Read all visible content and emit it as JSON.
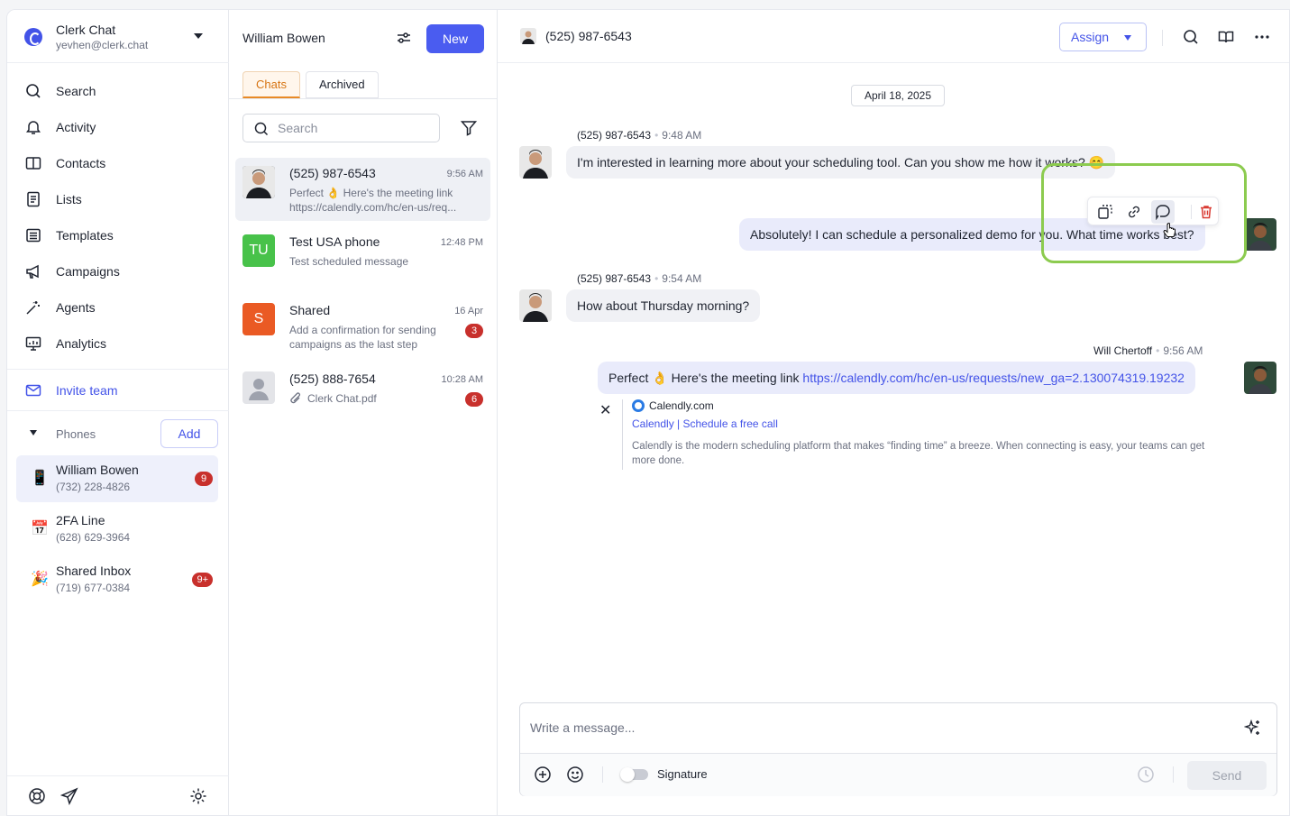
{
  "workspace": {
    "name": "Clerk Chat",
    "email": "yevhen@clerk.chat"
  },
  "nav": [
    {
      "label": "Search",
      "icon": "search-icon"
    },
    {
      "label": "Activity",
      "icon": "bell-icon"
    },
    {
      "label": "Contacts",
      "icon": "book-icon"
    },
    {
      "label": "Lists",
      "icon": "list-icon"
    },
    {
      "label": "Templates",
      "icon": "template-icon"
    },
    {
      "label": "Campaigns",
      "icon": "megaphone-icon"
    },
    {
      "label": "Agents",
      "icon": "wand-icon"
    },
    {
      "label": "Analytics",
      "icon": "chart-icon"
    }
  ],
  "invite": {
    "label": "Invite team"
  },
  "phones": {
    "label": "Phones",
    "add_label": "Add",
    "items": [
      {
        "name": "William Bowen",
        "number": "(732) 228-4826",
        "badge": "9"
      },
      {
        "name": "2FA Line",
        "number": "(628) 629-3964",
        "badge": ""
      },
      {
        "name": "Shared Inbox",
        "number": "(719) 677-0384",
        "badge": "9+"
      }
    ]
  },
  "list": {
    "title": "William Bowen",
    "new_label": "New",
    "tabs": [
      "Chats",
      "Archived"
    ],
    "search_placeholder": "Search",
    "conversations": [
      {
        "name": "(525) 987-6543",
        "time": "9:56 AM",
        "preview": "Perfect 👌 Here's the meeting link https://calendly.com/hc/en-us/req...",
        "avatar_text": "",
        "badge": ""
      },
      {
        "name": "Test USA phone",
        "time": "12:48 PM",
        "preview": "Test scheduled message",
        "avatar_text": "TU",
        "badge": ""
      },
      {
        "name": "Shared",
        "time": "16 Apr",
        "preview": "Add a confirmation for sending campaigns as the last step",
        "avatar_text": "S",
        "badge": "3"
      },
      {
        "name": "(525) 888-7654",
        "time": "10:28 AM",
        "preview": "Clerk Chat.pdf",
        "avatar_text": "",
        "badge": "6"
      }
    ]
  },
  "main": {
    "title": "(525) 987-6543",
    "assign_label": "Assign",
    "date_chip": "April 18, 2025",
    "messages": [
      {
        "sender": "(525) 987-6543",
        "time": "9:48 AM",
        "text": "I'm interested in learning more about your scheduling tool. Can you show me how it works? 😊"
      },
      {
        "sender": "",
        "time": "",
        "text": "Absolutely! I can schedule a personalized demo for you. What time works best?"
      },
      {
        "sender": "(525) 987-6543",
        "time": "9:54 AM",
        "text": "How about Thursday morning?"
      },
      {
        "sender": "Will Chertoff",
        "time": "9:56 AM",
        "text": "Perfect 👌 Here's the meeting link ",
        "link": "https://calendly.com/hc/en-us/requests/new_ga=2.130074319.19232"
      }
    ],
    "preview": {
      "site": "Calendly.com",
      "title": "Calendly | Schedule a free call",
      "description": "Calendly is the modern scheduling platform that makes “finding time” a breeze. When connecting is easy, your teams can get more done."
    },
    "composer": {
      "placeholder": "Write a message...",
      "signature_label": "Signature",
      "send_label": "Send"
    }
  },
  "colors": {
    "accent": "#4a5cf0",
    "badge": "#c8302c",
    "highlight": "#8ccb4f",
    "tab_active": "#e88a26"
  }
}
